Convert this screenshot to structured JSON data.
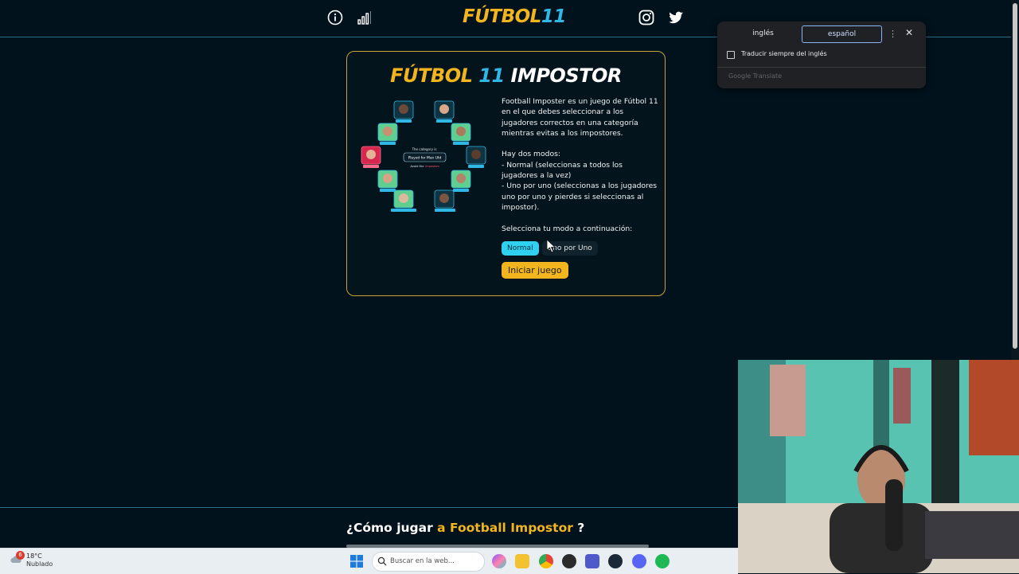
{
  "site": {
    "logo_main": "FÚTBOL",
    "logo_num": "11"
  },
  "game": {
    "title_main": "FÚTBOL",
    "title_num": "11",
    "title_rest": "IMPOSTOR",
    "description": [
      "Football Imposter es un juego de Fútbol 11 en el que debes seleccionar a los jugadores correctos en una categoría mientras evitas a los impostores.",
      "Hay dos modos:",
      "- Normal (seleccionas a todos los jugadores a la vez)",
      "- Uno por uno (seleccionas a los jugadores uno por uno y pierdes si seleccionas al impostor).",
      "Selecciona tu modo a continuación:"
    ],
    "modes": [
      "Normal",
      "Uno por Uno"
    ],
    "selected_mode": "Normal",
    "start_label": "Iniciar juego",
    "illustration": {
      "prompt_label": "The category is",
      "category": "Played for Man Utd",
      "avoid_label": "Avoid the",
      "avoid_word": "impostors"
    }
  },
  "howto": {
    "prefix": "¿Cómo jugar",
    "highlight": "a Football Impostor",
    "suffix": "?"
  },
  "translate_popup": {
    "lang_source": "inglés",
    "lang_target": "español",
    "always_translate": "Traducir siempre del inglés",
    "brand": "Google Translate",
    "menu_glyph": "⋮",
    "close_glyph": "✕"
  },
  "taskbar": {
    "weather_badge": "6",
    "temperature": "18°C",
    "condition": "Nublado",
    "search_placeholder": "Buscar en la web..."
  },
  "colors": {
    "background": "#01121c",
    "accent_yellow": "#f2b51d",
    "accent_blue": "#2fb7e6",
    "mode_active": "#2fd0f0",
    "card_border": "#c9a43a"
  },
  "icons": [
    "info-icon",
    "stats-icon",
    "instagram-icon",
    "twitter-icon",
    "cursor-icon",
    "windows-start-icon",
    "search-icon"
  ]
}
